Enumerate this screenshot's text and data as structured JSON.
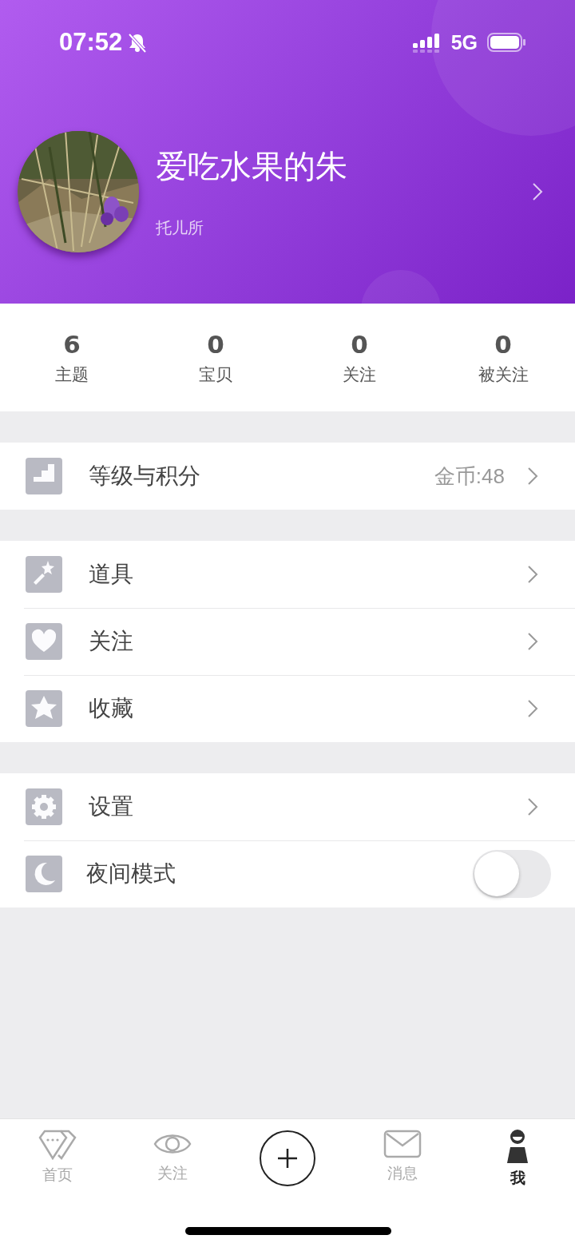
{
  "status_bar": {
    "time": "07:52",
    "network": "5G"
  },
  "profile": {
    "name": "爱吃水果的朱",
    "subtitle": "托儿所"
  },
  "stats": [
    {
      "value": "6",
      "label": "主题"
    },
    {
      "value": "0",
      "label": "宝贝"
    },
    {
      "value": "0",
      "label": "关注"
    },
    {
      "value": "0",
      "label": "被关注"
    }
  ],
  "menu_groups": [
    [
      {
        "kind": "link",
        "label": "等级与积分",
        "value": "金币:48"
      }
    ],
    [
      {
        "kind": "link",
        "label": "道具"
      },
      {
        "kind": "link",
        "label": "关注"
      },
      {
        "kind": "link",
        "label": "收藏"
      }
    ],
    [
      {
        "kind": "link",
        "label": "设置"
      },
      {
        "kind": "toggle",
        "label": "夜间模式",
        "on": false
      }
    ]
  ],
  "tabs": [
    {
      "label": "首页",
      "selected": false
    },
    {
      "label": "关注",
      "selected": false
    },
    {
      "kind": "add"
    },
    {
      "label": "消息",
      "selected": false
    },
    {
      "label": "我",
      "selected": true
    }
  ]
}
